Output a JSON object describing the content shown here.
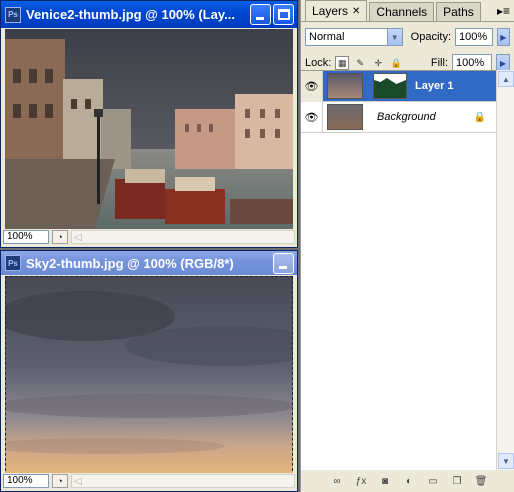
{
  "doc1": {
    "title": "Venice2-thumb.jpg @ 100% (Lay...",
    "zoom": "100%"
  },
  "doc2": {
    "title": "Sky2-thumb.jpg @ 100% (RGB/8*)",
    "zoom": "100%"
  },
  "panel": {
    "tabs": [
      {
        "label": "Layers"
      },
      {
        "label": "Channels"
      },
      {
        "label": "Paths"
      }
    ],
    "blend_mode": "Normal",
    "opacity_label": "Opacity:",
    "opacity_value": "100%",
    "lock_label": "Lock:",
    "fill_label": "Fill:",
    "fill_value": "100%",
    "layers": [
      {
        "name": "Layer 1",
        "selected": true
      },
      {
        "name": "Background",
        "selected": false
      }
    ]
  },
  "icon_ps": "Ps"
}
